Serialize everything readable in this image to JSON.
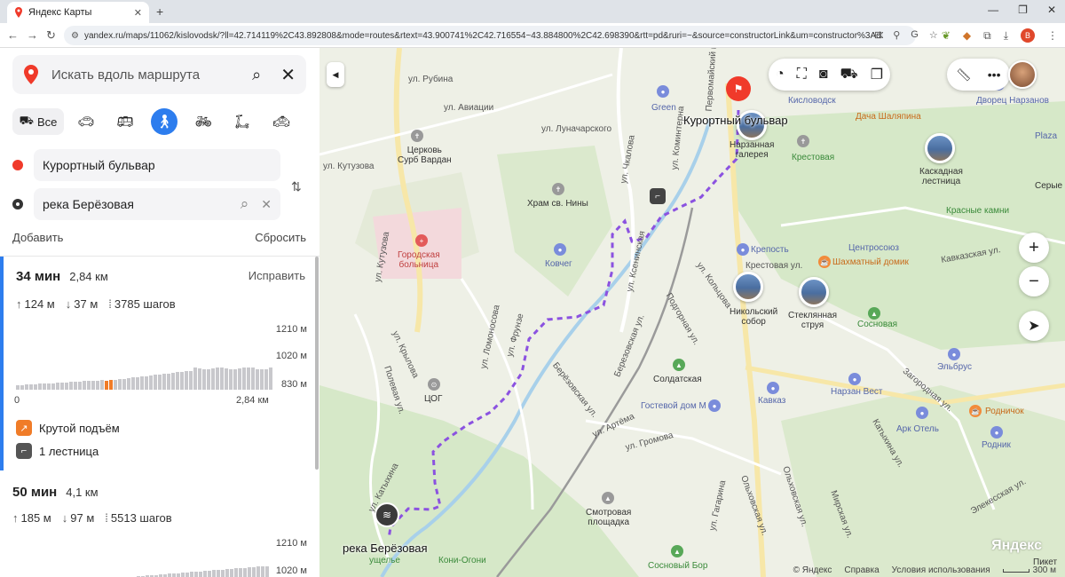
{
  "browser": {
    "tab_title": "Яндекс Карты",
    "url": "yandex.ru/maps/11062/kislovodsk/?ll=42.714119%2C43.892808&mode=routes&rtext=43.900741%2C42.716554~43.884800%2C42.698390&rtt=pd&ruri=~&source=constructorLink&um=constructor%3Ad31b3f76cc5c41848027...",
    "profile_letter": "B"
  },
  "sidebar": {
    "search_placeholder": "Искать вдоль маршрута",
    "modes": {
      "all_label": "Все"
    },
    "from": "Курортный бульвар",
    "to": "река Берёзовая",
    "add_label": "Добавить",
    "reset_label": "Сбросить",
    "routes": [
      {
        "time": "34 мин",
        "distance": "2,84 км",
        "fix_label": "Исправить",
        "ascent": "124 м",
        "descent": "37 м",
        "steps": "3785 шагов",
        "elev_max": "1210 м",
        "elev_mid": "1020 м",
        "elev_min": "830 м",
        "x_start": "0",
        "x_end": "2,84 км",
        "tags": [
          "Крутой подъём",
          "1 лестница"
        ]
      },
      {
        "time": "50 мин",
        "distance": "4,1 км",
        "ascent": "185 м",
        "descent": "97 м",
        "steps": "5513 шагов",
        "elev_max": "1210 м",
        "elev_mid": "1020 м"
      }
    ]
  },
  "map": {
    "start_label": "Курортный бульвар",
    "end_label": "река Берёзовая",
    "end_sublabel": "ущелье",
    "streets": [
      "ул. Рубина",
      "ул. Авиации",
      "ул. Луначарского",
      "ул. Кутузова",
      "ул. Кутузова",
      "ул. Чкалова",
      "ул. Ксенинская",
      "ул. Коминтерна",
      "ул. Кольцова",
      "Подгорная ул.",
      "ул. Ломоносова",
      "ул. Фрунзе",
      "ул. Крылова",
      "Полевая ул.",
      "ул. Катыхина",
      "Берёзовская ул.",
      "Березовская ул.",
      "ул. Артёма",
      "ул. Громова",
      "ул. Гагарина",
      "Ольховская ул.",
      "Крестовая ул.",
      "Кавказская ул.",
      "Первомайский пр.",
      "Ольховская ул.",
      "Мирская ул.",
      "Катыхина ул.",
      "Загородная ул.",
      "Элекесская ул."
    ],
    "places": {
      "green": "Green",
      "tserkov": "Церковь\nСурб Вардан",
      "khram": "Храм св. Нины",
      "hospital": "Городская\nбольница",
      "kovcheg": "Ковчег",
      "tsog": "ЦОГ",
      "soldatskaya": "Солдатская",
      "gostevoy": "Гостевой дом М",
      "kavkaz": "Кавказ",
      "smotrovaya": "Смотровая\nплощадка",
      "koni": "Кони-Огони",
      "sosnoviy_bor": "Сосновый Бор",
      "kislovodsk": "Кисловодск",
      "dacha": "Дача Шаляпина",
      "krestovaya": "Крестовая",
      "narzannaya": "Нарзанная\nгалерея",
      "kaskadnaya": "Каскадная\nлестница",
      "krasnye": "Красные камни",
      "tsentrosoyuz": "Центросоюз",
      "krepost": "Крепость",
      "shakhmatny": "Шахматный домик",
      "nikolsky": "Никольский\nсобор",
      "steklyannaya": "Стеклянная\nструя",
      "sosnovaya": "Сосновая",
      "elbrus": "Эльбрус",
      "narzan_vest": "Нарзан Вест",
      "rodnichok": "Родничок",
      "ark": "Арк Отель",
      "rodnik": "Родник",
      "dvorets": "Дворец Нарзанов",
      "plaza": "Plaza",
      "serye": "Серые",
      "piket": "Пикет"
    },
    "footer": {
      "copyright": "© Яндекс",
      "help": "Справка",
      "terms": "Условия использования",
      "scale": "300 м"
    },
    "logo": "Яндекс",
    "zoom_in": "+",
    "zoom_out": "−"
  },
  "colors": {
    "accent": "#2d7dee",
    "route": "#8b52e0",
    "start": "#f03a2a",
    "steep": "#f07c28"
  }
}
